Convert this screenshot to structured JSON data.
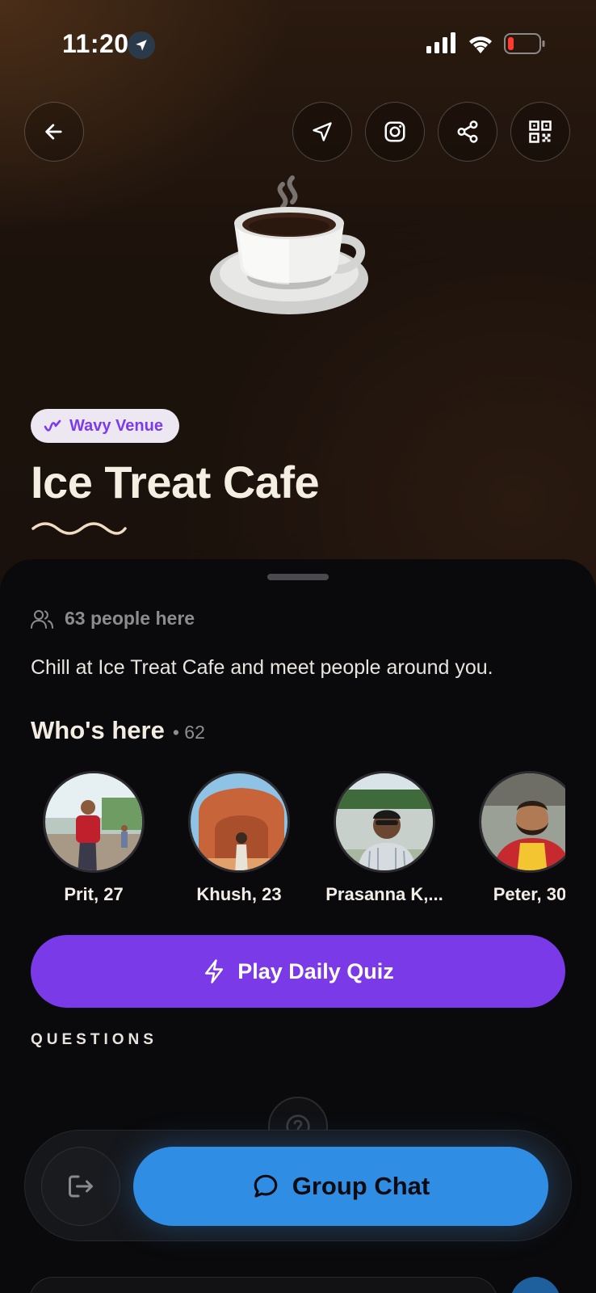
{
  "status_bar": {
    "time": "11:20",
    "icons": [
      "location-arrow-icon",
      "cellular-signal-icon",
      "wifi-icon",
      "battery-low-icon"
    ]
  },
  "nav": {
    "back_icon": "back-arrow-icon",
    "actions": [
      "navigate-icon",
      "instagram-icon",
      "share-icon",
      "qr-code-icon"
    ]
  },
  "venue": {
    "badge_label": "Wavy Venue",
    "name": "Ice Treat Cafe",
    "hero_icon": "coffee-cup-icon"
  },
  "info": {
    "people_count": "63 people here",
    "description": "Chill at Ice Treat Cafe and meet people around you."
  },
  "whos_here": {
    "title": "Who's here",
    "count": "• 62",
    "people": [
      {
        "name": "Prit, 27"
      },
      {
        "name": "Khush, 23"
      },
      {
        "name": "Prasanna K,..."
      },
      {
        "name": "Peter, 30"
      }
    ]
  },
  "quiz": {
    "label": "Play Daily Quiz"
  },
  "questions": {
    "section_label": "QUESTIONS"
  },
  "bottom_bar": {
    "chat_label": "Group Chat"
  },
  "colors": {
    "accent_purple": "#7a3ae8",
    "chat_blue": "#2f8de4",
    "background": "#0a0a0c"
  }
}
